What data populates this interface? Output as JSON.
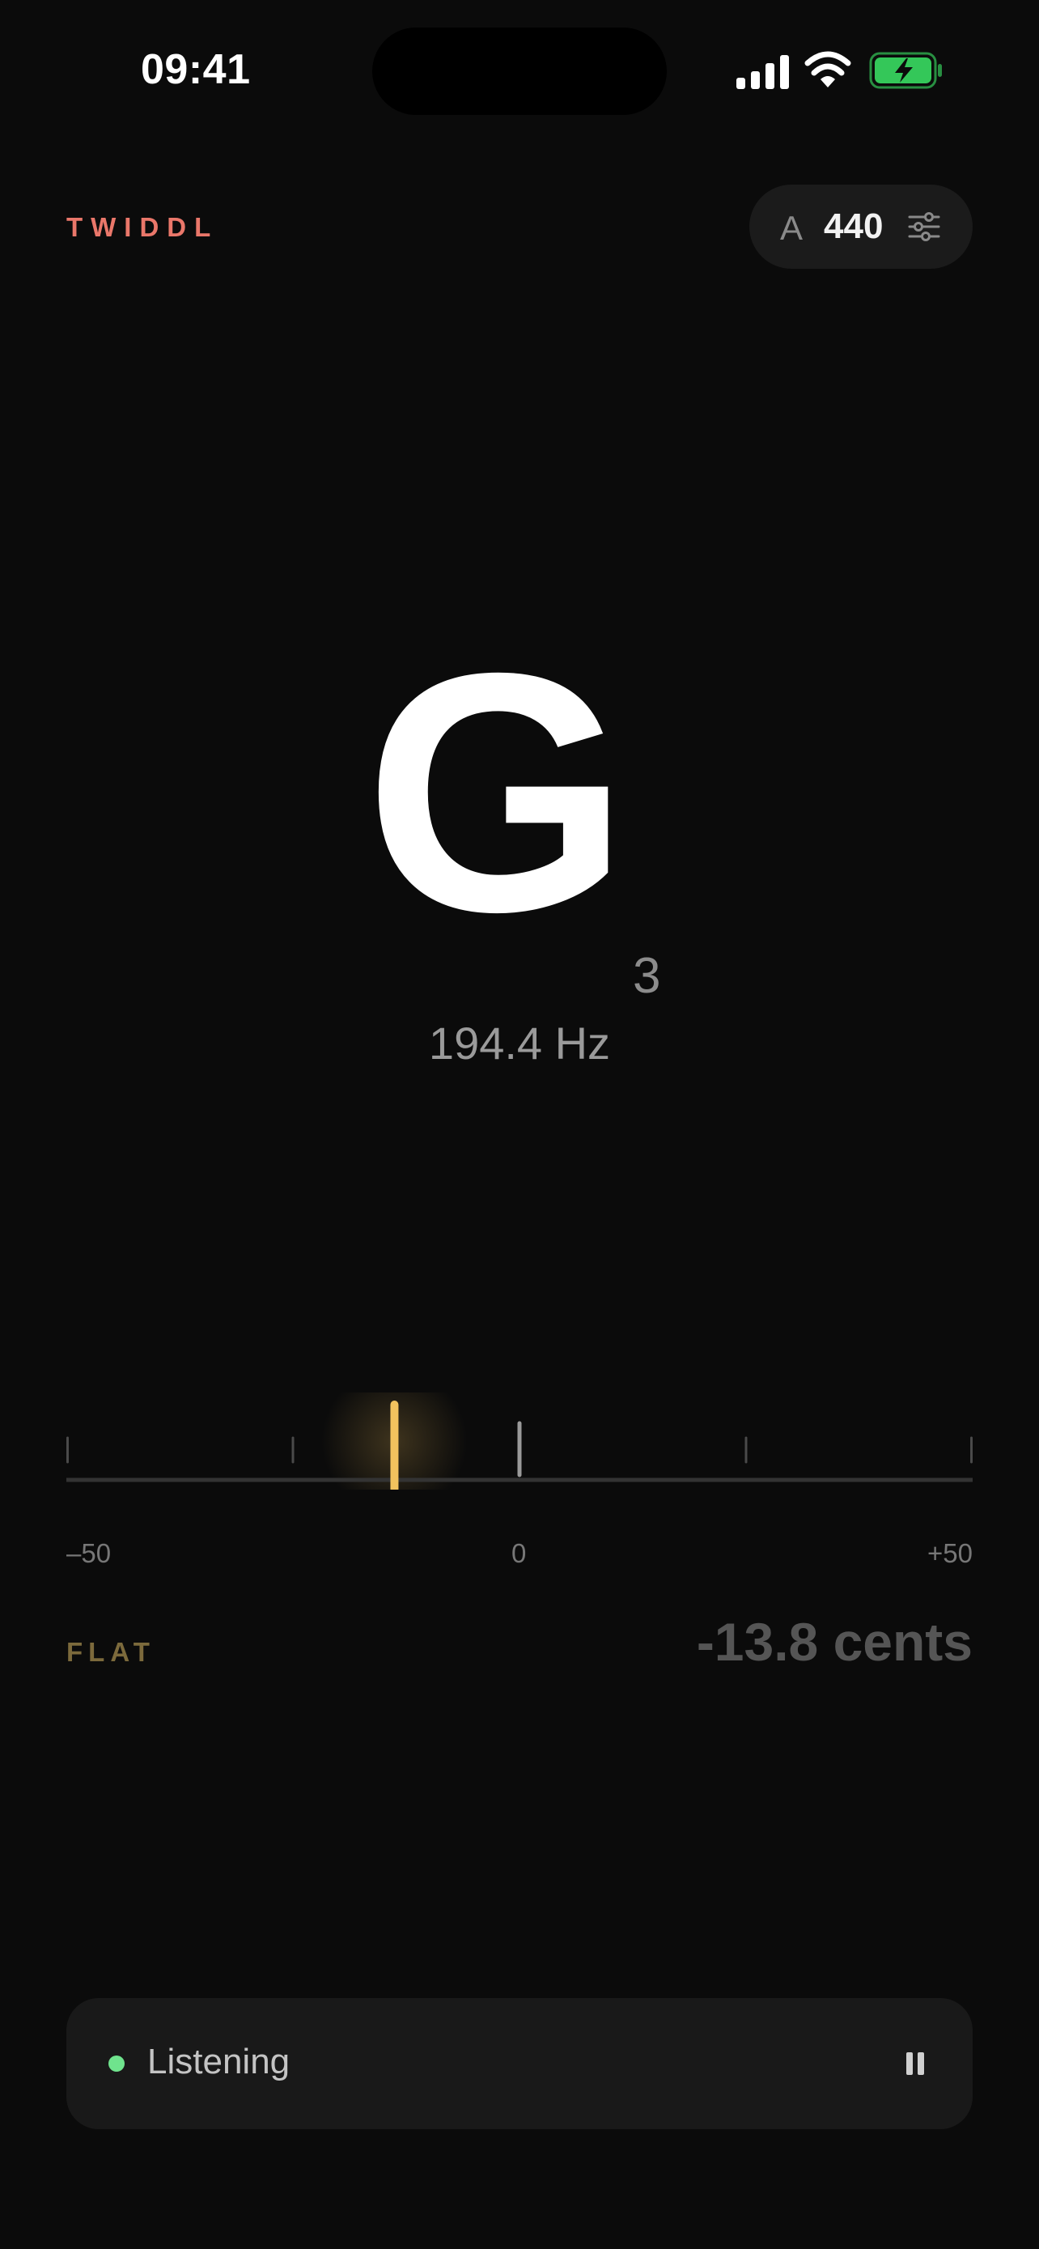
{
  "status_bar": {
    "time": "09:41",
    "icons": [
      "signal-icon",
      "wifi-icon",
      "battery-charging-icon"
    ]
  },
  "header": {
    "brand": "TWIDDL",
    "reference": {
      "note": "A",
      "value": "440",
      "icon": "sliders-icon"
    }
  },
  "reading": {
    "note": "G",
    "octave": "3",
    "frequency": "194.4 Hz"
  },
  "meter": {
    "min_label": "–50",
    "zero_label": "0",
    "max_label": "+50",
    "range_cents": [
      -50,
      50
    ],
    "needle_cents": -13.8
  },
  "tuning": {
    "direction": "FLAT",
    "cents_text": "-13.8 cents"
  },
  "listen_bar": {
    "label": "Listening",
    "state": "listening",
    "action_icon": "pause-icon"
  },
  "colors": {
    "background": "#0b0b0b",
    "brand": "#ea776a",
    "needle": "#f2c25e",
    "listening": "#6fe38d",
    "battery": "#34c759"
  }
}
